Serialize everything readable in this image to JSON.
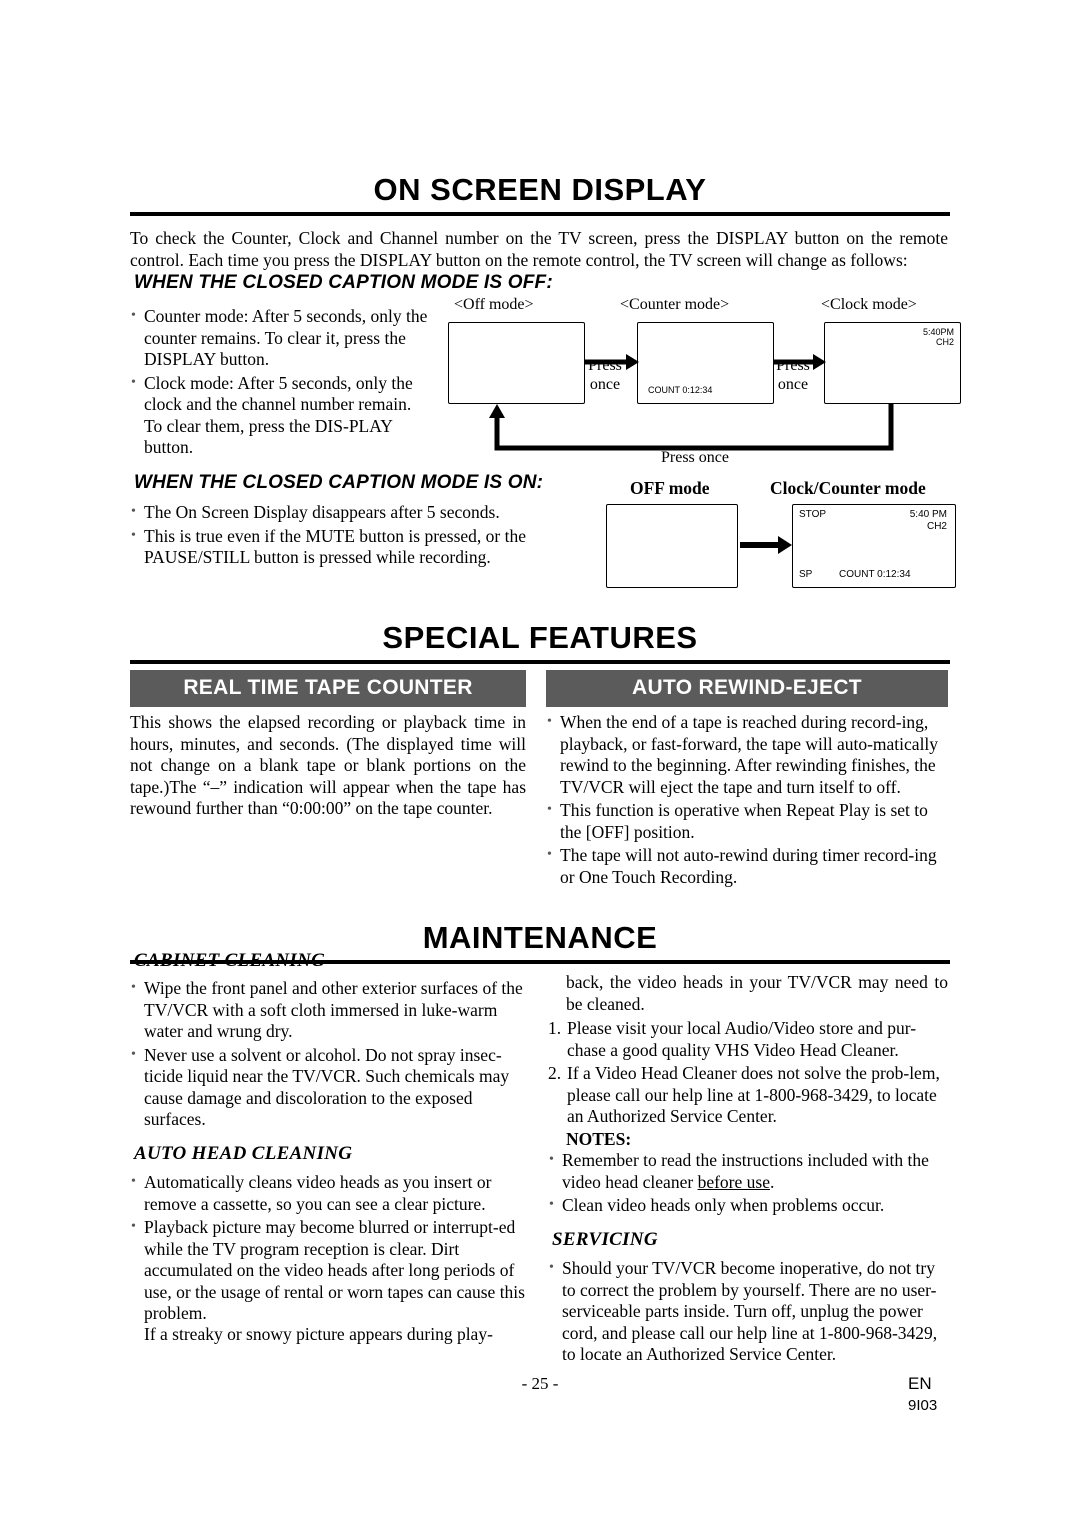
{
  "sections": {
    "on_screen_display": {
      "title": "ON SCREEN DISPLAY",
      "intro": "To check the Counter, Clock and Channel number on the TV screen, press the DISPLAY button on the remote control. Each time you press the DISPLAY button on the remote control, the TV screen will change as follows:",
      "cc_off_heading": "WHEN THE CLOSED CAPTION MODE IS OFF:",
      "cc_off_bullets": [
        "Counter mode: After 5 seconds, only the counter remains. To clear it, press the DISPLAY button.",
        "Clock mode: After 5 seconds, only the clock and the channel number remain. To clear them, press the DIS-PLAY button."
      ],
      "cc_on_heading": "WHEN THE CLOSED CAPTION MODE IS ON:",
      "cc_on_bullets": [
        "The On Screen Display disappears after 5 seconds.",
        "This is true even if the MUTE button is pressed, or the PAUSE/STILL button is pressed while recording."
      ],
      "diagram": {
        "label_off_mode": "<Off mode>",
        "label_counter_mode": "<Counter mode>",
        "label_clock_mode": "<Clock mode>",
        "press_once_1": "Press\nonce",
        "press_once_2": "Press\nonce",
        "press_once_bottom": "Press once",
        "counter_screen_text": "COUNT  0:12:34",
        "clock_screen_time": "5:40PM",
        "clock_screen_channel": "CH2",
        "off_mode_label": "OFF mode",
        "clock_counter_mode_label": "Clock/Counter mode",
        "cc_screen_stop": "STOP",
        "cc_screen_time": "5:40 PM",
        "cc_screen_channel": "CH2",
        "cc_screen_sp": "SP",
        "cc_screen_count": "COUNT  0:12:34"
      }
    },
    "special_features": {
      "title": "SPECIAL FEATURES",
      "left_bar": "REAL TIME TAPE COUNTER",
      "right_bar": "AUTO REWIND-EJECT",
      "left_text": "This shows the elapsed recording or playback time in hours, minutes, and seconds. (The displayed time will not change on a blank tape or blank portions on the tape.)The “–” indication will appear when the tape has rewound further than “0:00:00” on the tape counter.",
      "right_bullets": [
        "When the end of a tape is reached during record-ing, playback, or fast-forward, the tape will auto-matically rewind to the beginning. After rewinding finishes, the TV/VCR will eject the tape and turn itself to off.",
        "This function is operative when Repeat Play is set to the [OFF] position.",
        "The tape will not auto-rewind during timer record-ing or One Touch Recording."
      ]
    },
    "maintenance": {
      "title": "MAINTENANCE",
      "cabinet_cleaning_heading": "CABINET CLEANING",
      "cabinet_cleaning_bullets": [
        "Wipe the front panel and other exterior surfaces of the TV/VCR with a soft cloth immersed in luke-warm water and wrung dry.",
        "Never use a solvent or alcohol. Do not spray insec-ticide liquid near the TV/VCR. Such chemicals may cause damage and discoloration to the exposed surfaces."
      ],
      "auto_head_cleaning_heading": "AUTO HEAD CLEANING",
      "auto_head_cleaning_bullets": [
        "Automatically cleans video heads as you insert or remove a cassette, so you can see a clear picture.",
        "Playback picture may become blurred or interrupt-ed while the TV program reception is clear. Dirt accumulated on the video heads after long periods of use, or the usage of rental or worn tapes can cause this problem."
      ],
      "auto_head_trailing": "If a streaky or snowy picture appears during play-",
      "right_continued": "back, the video heads in your TV/VCR may need to be cleaned.",
      "numbered": [
        {
          "num": "1.",
          "text": "Please visit your local Audio/Video store and pur-chase a good quality VHS Video Head Cleaner."
        },
        {
          "num": "2.",
          "text": "If a Video Head Cleaner does not solve the prob-lem, please call our help line at 1-800-968-3429, to locate an Authorized Service Center."
        }
      ],
      "notes_label": "NOTES:",
      "notes_bullets_a": "Remember to read the instructions included with the video head cleaner ",
      "notes_bullets_a_underline": "before use",
      "notes_bullets_a_tail": ".",
      "notes_bullets_b": "Clean video heads only when problems occur.",
      "servicing_heading": "SERVICING",
      "servicing_bullet": "Should your TV/VCR become inoperative, do not try to correct the problem by yourself. There are no user-serviceable parts inside. Turn off, unplug the power cord, and please call our help line at 1-800-968-3429, to locate an Authorized Service Center."
    }
  },
  "footer": {
    "page_number": "- 25 -",
    "language": "EN",
    "code": "9I03"
  }
}
